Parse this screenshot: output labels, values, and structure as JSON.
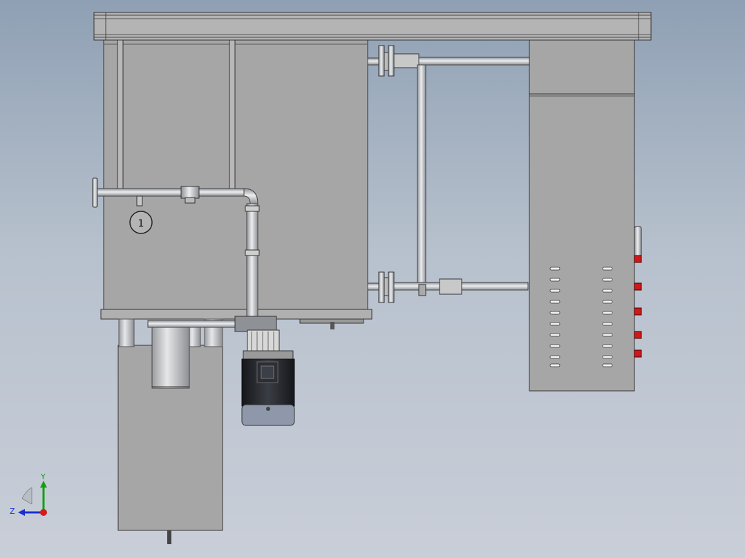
{
  "viewport": {
    "background_top": "#8fa0b4",
    "background_bottom": "#c9ced8"
  },
  "model": {
    "gauge_reading": "1",
    "metal_color": "#a9a9a9",
    "pipe_color": "#d2d4d6",
    "indicator_light_color": "#d01818",
    "motor_color": "#222428"
  },
  "triad": {
    "y_label": "Y",
    "z_label": "Z",
    "y_color": "#12a012",
    "z_color": "#1a2fd0",
    "x_color": "#d81a1a"
  }
}
